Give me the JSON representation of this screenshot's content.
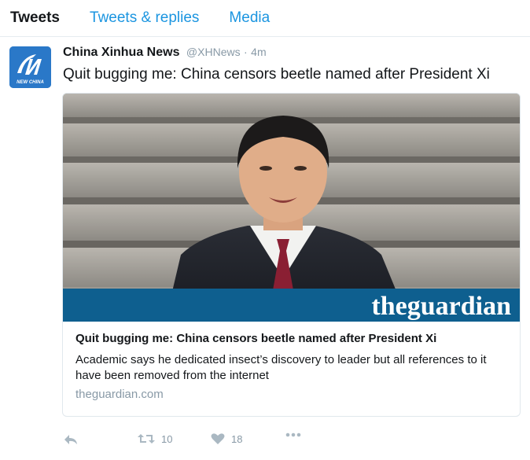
{
  "tabs": [
    {
      "label": "Tweets",
      "active": true
    },
    {
      "label": "Tweets & replies",
      "active": false
    },
    {
      "label": "Media",
      "active": false
    }
  ],
  "tweet": {
    "author_name": "China Xinhua News",
    "author_handle": "@XHNews",
    "separator": "·",
    "time": "4m",
    "avatar_text": "NEW CHINA",
    "text": "Quit bugging me: China censors beetle named after President Xi",
    "card": {
      "image_brand": "theguardian",
      "title": "Quit bugging me: China censors beetle named after President Xi",
      "description": "Academic says he dedicated insect’s discovery to leader but all references to it have been removed from the internet",
      "domain": "theguardian.com"
    },
    "actions": {
      "reply_icon": "reply-icon",
      "retweet_count": "10",
      "like_count": "18",
      "more_icon": "more-icon"
    }
  },
  "colors": {
    "link_blue": "#1b95e0",
    "muted": "#8899a6",
    "border": "#e6ecf0",
    "guardian_band": "#0e5f8f"
  }
}
